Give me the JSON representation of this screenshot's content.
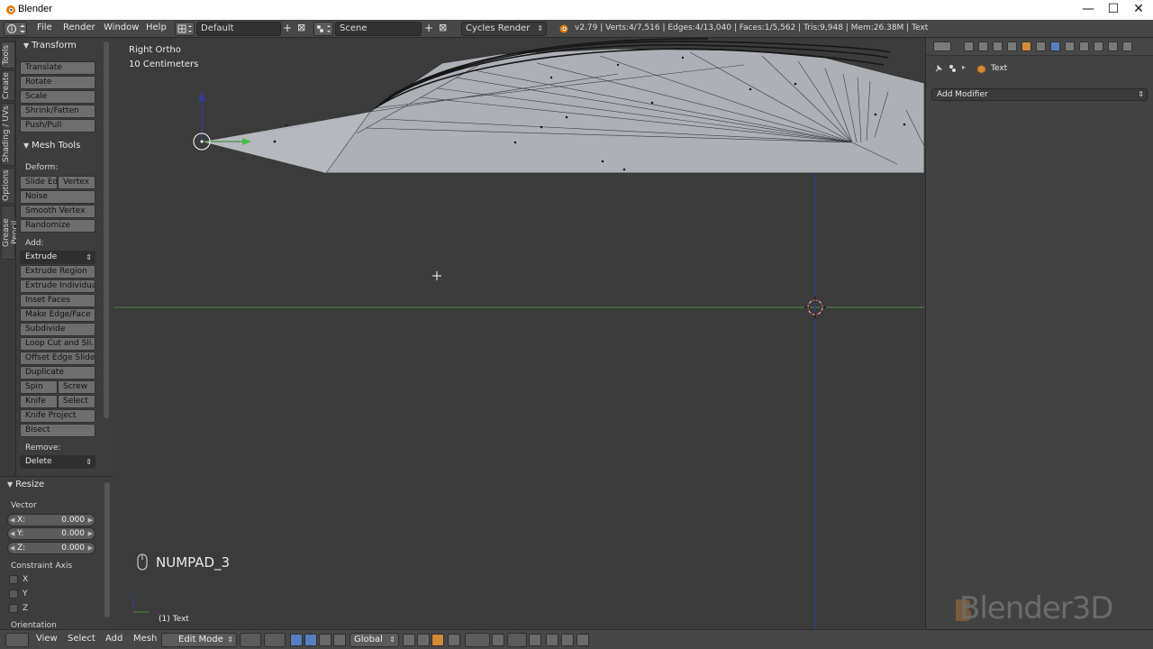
{
  "window": {
    "title": "Blender",
    "controls": [
      "minimize-icon",
      "maximize-icon",
      "close-icon"
    ]
  },
  "info_header": {
    "menus": [
      "File",
      "Render",
      "Window",
      "Help"
    ],
    "screen_layout": "Default",
    "scene": "Scene",
    "render_engine": "Cycles Render",
    "stats": "v2.79 | Verts:4/7,516 | Edges:4/13,040 | Faces:1/5,562 | Tris:9,948 | Mem:26.38M | Text"
  },
  "tool_tabs": [
    "Tools",
    "Create",
    "Shading / UVs",
    "Options",
    "Grease Pencil"
  ],
  "toolshelf": {
    "transform": {
      "title": "Transform",
      "buttons": [
        "Translate",
        "Rotate",
        "Scale",
        "Shrink/Fatten",
        "Push/Pull"
      ]
    },
    "mesh_tools": {
      "title": "Mesh Tools",
      "deform_label": "Deform:",
      "deform_row": [
        "Slide Ed",
        "Vertex"
      ],
      "deform_buttons": [
        "Noise",
        "Smooth Vertex",
        "Randomize"
      ],
      "add_label": "Add:",
      "extrude_menu": "Extrude",
      "add_buttons": [
        "Extrude Region",
        "Extrude Individual",
        "Inset Faces",
        "Make Edge/Face",
        "Subdivide",
        "Loop Cut and Sli...",
        "Offset Edge Slide",
        "Duplicate"
      ],
      "row_spin": [
        "Spin",
        "Screw"
      ],
      "row_knife": [
        "Knife",
        "Select"
      ],
      "more_buttons": [
        "Knife Project",
        "Bisect"
      ],
      "remove_label": "Remove:",
      "delete_menu": "Delete"
    }
  },
  "operator_panel": {
    "title": "Resize",
    "vector_label": "Vector",
    "fields": [
      {
        "label": "X:",
        "value": "0.000"
      },
      {
        "label": "Y:",
        "value": "0.000"
      },
      {
        "label": "Z:",
        "value": "0.000"
      }
    ],
    "constraint_label": "Constraint Axis",
    "constraints": [
      "X",
      "Y",
      "Z"
    ],
    "orientation_label": "Orientation"
  },
  "viewport": {
    "view_name": "Right Ortho",
    "grid_scale": "10 Centimeters",
    "key_display": "NUMPAD_3",
    "object_info": "(1) Text"
  },
  "properties": {
    "breadcrumb_object": "Text",
    "add_modifier": "Add Modifier",
    "watermark": "Blender3D"
  },
  "bottom_header": {
    "menus": [
      "View",
      "Select",
      "Add",
      "Mesh"
    ],
    "mode": "Edit Mode",
    "orientation": "Global"
  },
  "colors": {
    "viewport_bg": "#3b3b3b",
    "mesh_face": "#aeb0b7",
    "y_axis": "#4b8f3c",
    "z_axis": "#2d3ea0",
    "active_icon": "#5680c2"
  }
}
